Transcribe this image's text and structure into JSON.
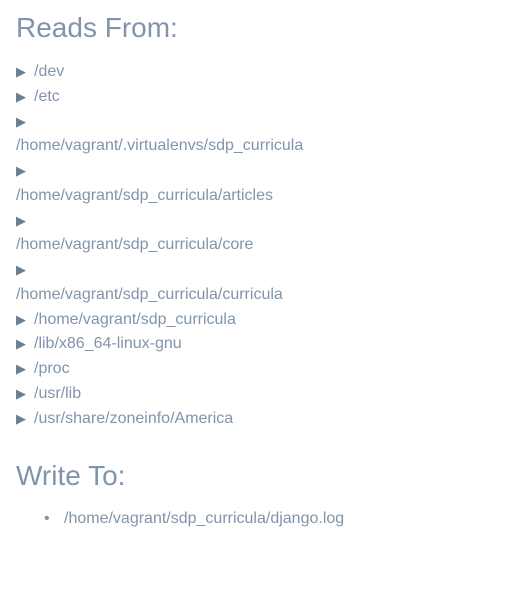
{
  "sections": {
    "reads": {
      "title": "Reads From:",
      "items": [
        {
          "path": "/dev",
          "wrap": false
        },
        {
          "path": "/etc",
          "wrap": false
        },
        {
          "path": "/home/vagrant/.virtualenvs/sdp_curricula",
          "wrap": true
        },
        {
          "path": "/home/vagrant/sdp_curricula/articles",
          "wrap": true
        },
        {
          "path": "/home/vagrant/sdp_curricula/core",
          "wrap": true
        },
        {
          "path": "/home/vagrant/sdp_curricula/curricula",
          "wrap": true
        },
        {
          "path": "/home/vagrant/sdp_curricula",
          "wrap": false
        },
        {
          "path": "/lib/x86_64-linux-gnu",
          "wrap": false
        },
        {
          "path": "/proc",
          "wrap": false
        },
        {
          "path": "/usr/lib",
          "wrap": false
        },
        {
          "path": "/usr/share/zoneinfo/America",
          "wrap": false
        }
      ]
    },
    "writes": {
      "title": "Write To:",
      "items": [
        {
          "path": "/home/vagrant/sdp_curricula/django.log"
        }
      ]
    }
  },
  "icons": {
    "expand_arrow": "▶"
  }
}
